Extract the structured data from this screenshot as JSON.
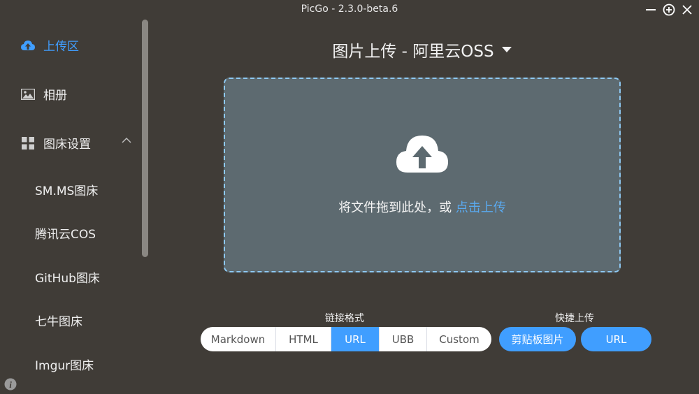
{
  "window": {
    "title": "PicGo - 2.3.0-beta.6"
  },
  "sidebar": {
    "items": [
      {
        "label": "上传区",
        "icon": "upload-cloud-icon",
        "active": true
      },
      {
        "label": "相册",
        "icon": "picture-icon"
      },
      {
        "label": "图床设置",
        "icon": "grid-icon",
        "expanded": true
      }
    ],
    "subitems": [
      "SM.MS图床",
      "腾讯云COS",
      "GitHub图床",
      "七牛图床",
      "Imgur图床"
    ]
  },
  "main": {
    "title": "图片上传 - 阿里云OSS",
    "drop_text": "将文件拖到此处，或",
    "drop_link": "点击上传",
    "link_format_label": "链接格式",
    "formats": [
      "Markdown",
      "HTML",
      "URL",
      "UBB",
      "Custom"
    ],
    "selected_format": "URL",
    "quick_upload_label": "快捷上传",
    "quick_buttons": [
      "剪贴板图片",
      "URL"
    ]
  },
  "colors": {
    "accent": "#409eff",
    "background": "#403c37",
    "dropzone": "#5d6a70"
  }
}
